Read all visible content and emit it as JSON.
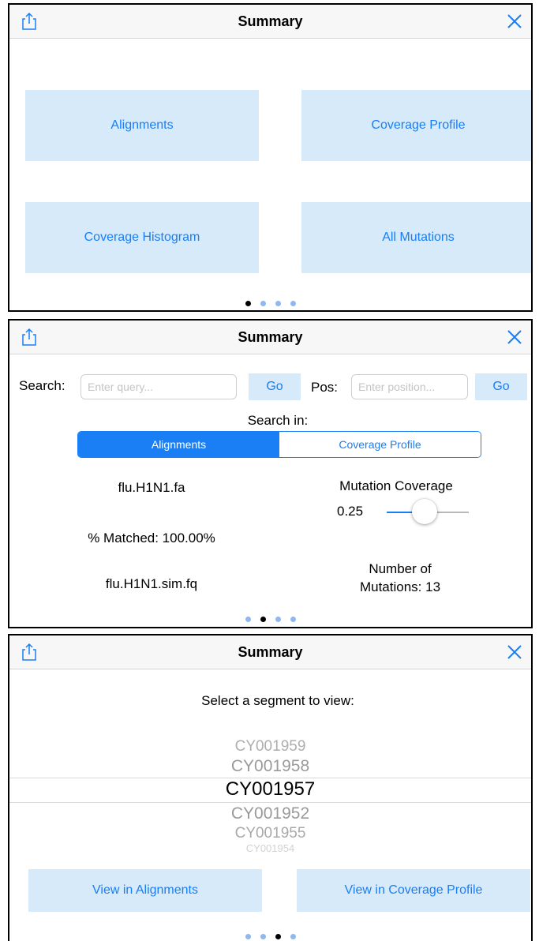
{
  "panels": [
    {
      "title": "Summary",
      "tiles": [
        "Alignments",
        "Coverage Profile",
        "Coverage Histogram",
        "All Mutations"
      ],
      "page_index": 0
    },
    {
      "title": "Summary",
      "search": {
        "label": "Search:",
        "placeholder": "Enter query...",
        "go": "Go"
      },
      "pos": {
        "label": "Pos:",
        "placeholder": "Enter position...",
        "go": "Go"
      },
      "search_in": "Search in:",
      "segments": [
        "Alignments",
        "Coverage Profile"
      ],
      "selected_segment": "Alignments",
      "reference_file": "flu.H1N1.fa",
      "matched": "% Matched:  100.00%",
      "reads_file": "flu.H1N1.sim.fq",
      "mutation_coverage_label": "Mutation Coverage",
      "mutation_coverage_value": "0.25",
      "mutation_coverage_slider": 0.25,
      "num_mutations_line1": "Number of",
      "num_mutations_line2": "Mutations: 13",
      "page_index": 1
    },
    {
      "title": "Summary",
      "prompt": "Select a segment to view:",
      "picker": [
        "CY001959",
        "CY001958",
        "CY001957",
        "CY001952",
        "CY001955",
        "CY001954"
      ],
      "picker_selected": "CY001957",
      "view_alignments": "View in Alignments",
      "view_coverage": "View in Coverage Profile",
      "page_index": 2
    }
  ],
  "page_count": 4,
  "colors": {
    "accent": "#1a7ef5",
    "tile_bg": "#d6eafa",
    "nav_bg": "#f7f7f7"
  },
  "icons": {
    "left": "share-icon",
    "right": "close-icon"
  }
}
